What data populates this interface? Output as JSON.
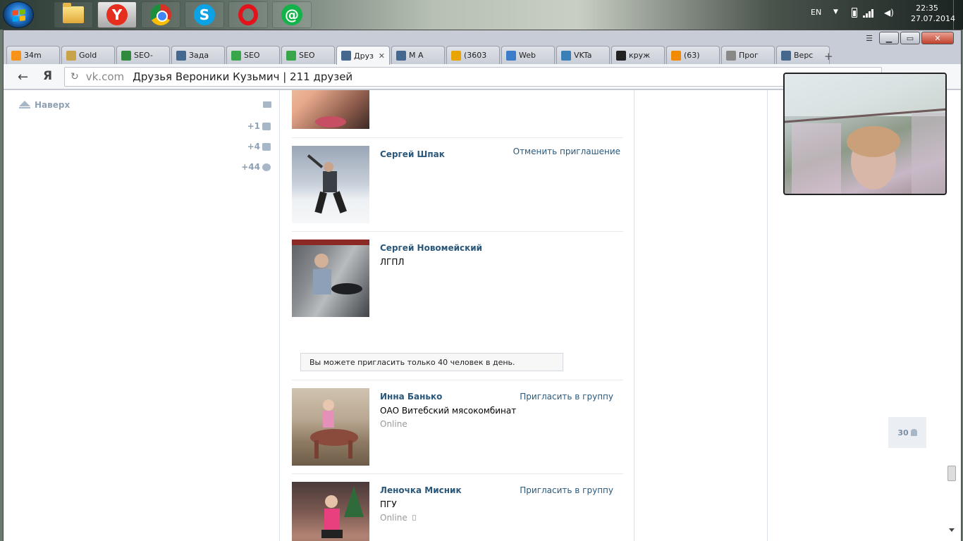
{
  "taskbar": {
    "apps": [
      {
        "name": "explorer",
        "icon": "folder-icon"
      },
      {
        "name": "yandex-browser",
        "icon": "yandex-icon",
        "glyph": "Y"
      },
      {
        "name": "chrome",
        "icon": "chrome-icon"
      },
      {
        "name": "skype",
        "icon": "skype-icon",
        "glyph": "S"
      },
      {
        "name": "opera",
        "icon": "opera-icon"
      },
      {
        "name": "mail-agent",
        "icon": "mail-agent-icon",
        "glyph": "@"
      }
    ],
    "tray": {
      "language": "EN",
      "time": "22:35",
      "date": "27.07.2014"
    }
  },
  "browser": {
    "tabs": [
      {
        "label": "34m",
        "icon": "bitcoin-icon",
        "color": "#f7931a"
      },
      {
        "label": "Gold",
        "icon": "g-icon",
        "color": "#c9a24a"
      },
      {
        "label": "SEO-",
        "icon": "sf-icon",
        "color": "#2f8a3d"
      },
      {
        "label": "Зада",
        "icon": "vk-icon",
        "color": "#45688e"
      },
      {
        "label": "SEO",
        "icon": "seo-icon",
        "color": "#3aa64b"
      },
      {
        "label": "SEO",
        "icon": "seo-icon",
        "color": "#3aa64b"
      },
      {
        "label": "Друз",
        "icon": "vk-icon",
        "color": "#45688e",
        "active": true
      },
      {
        "label": "М А",
        "icon": "vk-icon",
        "color": "#45688e"
      },
      {
        "label": "(3603",
        "icon": "mail-icon",
        "color": "#e8a400"
      },
      {
        "label": "Web",
        "icon": "globe-icon",
        "color": "#3d7cc9"
      },
      {
        "label": "VKTa",
        "icon": "target-icon",
        "color": "#3a7fb5"
      },
      {
        "label": "круж",
        "icon": "play-icon",
        "color": "#222"
      },
      {
        "label": "(63)",
        "icon": "odnoklassniki-icon",
        "color": "#f28a00"
      },
      {
        "label": "Прог",
        "icon": "page-icon",
        "color": "#888"
      },
      {
        "label": "Верс",
        "icon": "vk-icon",
        "color": "#45688e"
      }
    ],
    "address": {
      "host": "vk.com",
      "title": "Друзья Вероники Кузьмич | 211 друзей"
    }
  },
  "left": {
    "to_top": "Наверх",
    "counters": [
      "+1",
      "+4",
      "+44"
    ]
  },
  "friends": [
    {
      "name": "",
      "sub": "",
      "online": "",
      "action": ""
    },
    {
      "name": "Сергей Шпак",
      "sub": "",
      "online": "",
      "action": "Отменить приглашение"
    },
    {
      "name": "Сергей Новомейский",
      "sub": "ЛГПЛ",
      "online": "",
      "action": ""
    },
    {
      "name": "Инна Банько",
      "sub": "ОАО Витебский мясокомбинат",
      "online": "Online",
      "action": "Пригласить в группу"
    },
    {
      "name": "Леночка Мисник",
      "sub": "ПГУ",
      "online": "Online",
      "action": "Пригласить в группу"
    }
  ],
  "notice": "Вы можете пригласить только 40 человек в день.",
  "right_counter": "30",
  "colors": {
    "link": "#2b587a",
    "muted": "#8fa1b4",
    "online": "#999999"
  }
}
